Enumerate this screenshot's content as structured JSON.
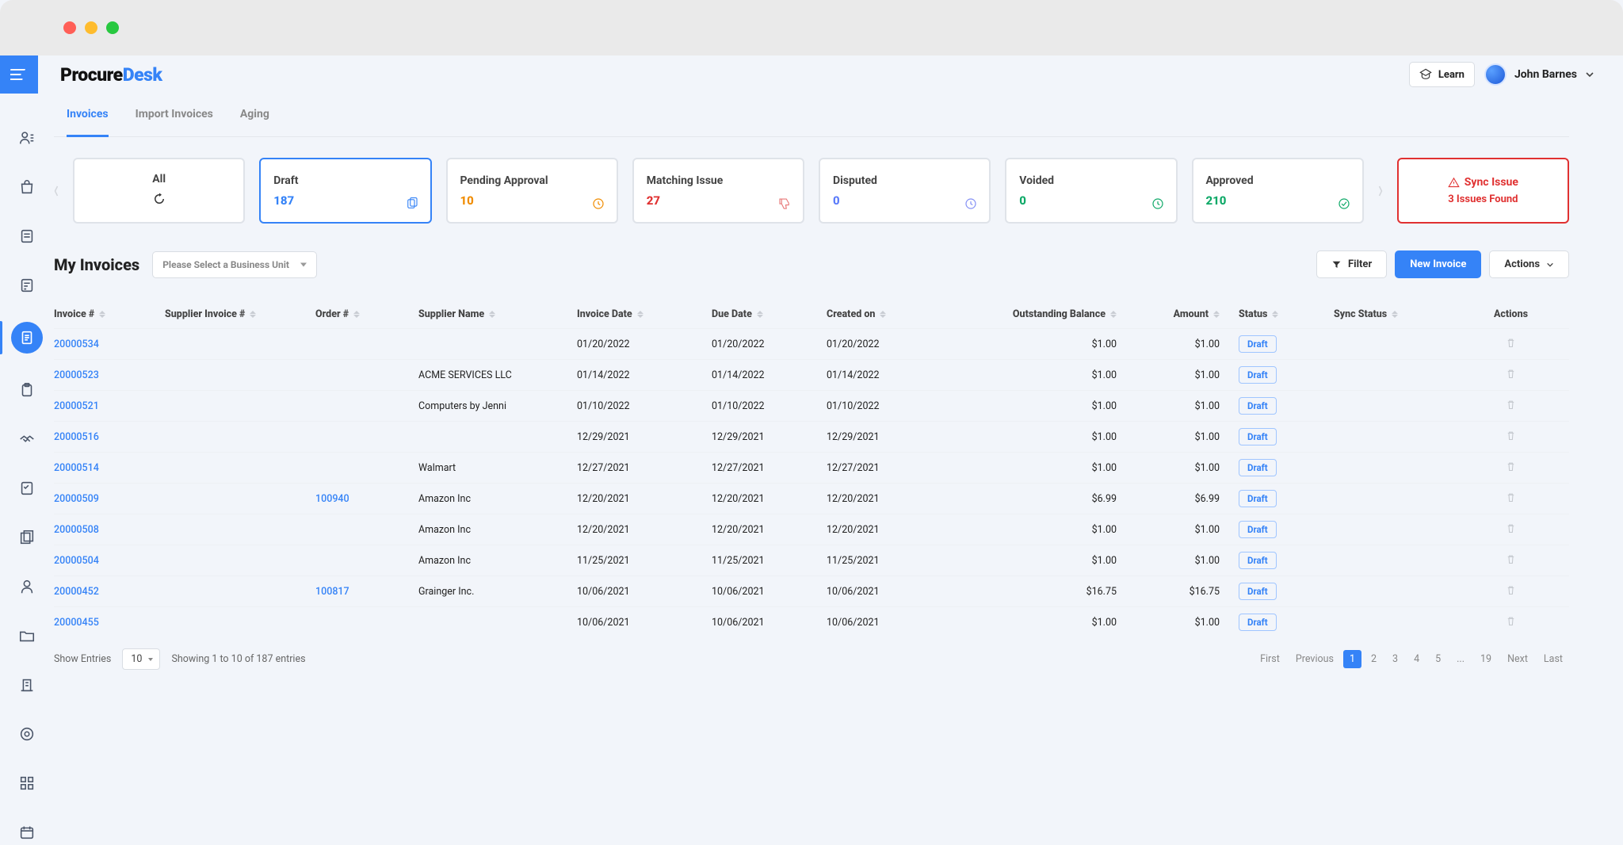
{
  "brand": {
    "p1": "Procure",
    "p2": "Desk"
  },
  "top": {
    "learn": "Learn",
    "user": "John Barnes"
  },
  "tabs": [
    {
      "label": "Invoices",
      "active": true
    },
    {
      "label": "Import Invoices",
      "active": false
    },
    {
      "label": "Aging",
      "active": false
    }
  ],
  "cards": {
    "all": {
      "title": "All"
    },
    "draft": {
      "title": "Draft",
      "count": "187"
    },
    "pending": {
      "title": "Pending Approval",
      "count": "10"
    },
    "matching": {
      "title": "Matching Issue",
      "count": "27"
    },
    "disputed": {
      "title": "Disputed",
      "count": "0"
    },
    "voided": {
      "title": "Voided",
      "count": "0"
    },
    "approved": {
      "title": "Approved",
      "count": "210"
    },
    "sync": {
      "line1": "Sync Issue",
      "line2": "3 Issues Found"
    }
  },
  "section": {
    "title": "My Invoices",
    "bu_placeholder": "Please Select a Business Unit",
    "filter": "Filter",
    "new": "New Invoice",
    "actions": "Actions"
  },
  "columns": {
    "invoice": "Invoice #",
    "sinvoice": "Supplier Invoice #",
    "order": "Order #",
    "sname": "Supplier Name",
    "idate": "Invoice Date",
    "ddate": "Due Date",
    "cdate": "Created on",
    "obal": "Outstanding Balance",
    "amount": "Amount",
    "status": "Status",
    "sync": "Sync Status",
    "actions": "Actions"
  },
  "rows": [
    {
      "inv": "20000534",
      "sinv": "",
      "order": "",
      "sname": "",
      "idate": "01/20/2022",
      "ddate": "01/20/2022",
      "cdate": "01/20/2022",
      "obal": "$1.00",
      "amount": "$1.00",
      "status": "Draft"
    },
    {
      "inv": "20000523",
      "sinv": "",
      "order": "",
      "sname": "ACME SERVICES LLC",
      "idate": "01/14/2022",
      "ddate": "01/14/2022",
      "cdate": "01/14/2022",
      "obal": "$1.00",
      "amount": "$1.00",
      "status": "Draft"
    },
    {
      "inv": "20000521",
      "sinv": "",
      "order": "",
      "sname": "Computers by Jenni",
      "idate": "01/10/2022",
      "ddate": "01/10/2022",
      "cdate": "01/10/2022",
      "obal": "$1.00",
      "amount": "$1.00",
      "status": "Draft"
    },
    {
      "inv": "20000516",
      "sinv": "",
      "order": "",
      "sname": "",
      "idate": "12/29/2021",
      "ddate": "12/29/2021",
      "cdate": "12/29/2021",
      "obal": "$1.00",
      "amount": "$1.00",
      "status": "Draft"
    },
    {
      "inv": "20000514",
      "sinv": "",
      "order": "",
      "sname": "Walmart",
      "idate": "12/27/2021",
      "ddate": "12/27/2021",
      "cdate": "12/27/2021",
      "obal": "$1.00",
      "amount": "$1.00",
      "status": "Draft"
    },
    {
      "inv": "20000509",
      "sinv": "",
      "order": "100940",
      "sname": "Amazon Inc",
      "idate": "12/20/2021",
      "ddate": "12/20/2021",
      "cdate": "12/20/2021",
      "obal": "$6.99",
      "amount": "$6.99",
      "status": "Draft"
    },
    {
      "inv": "20000508",
      "sinv": "",
      "order": "",
      "sname": "Amazon Inc",
      "idate": "12/20/2021",
      "ddate": "12/20/2021",
      "cdate": "12/20/2021",
      "obal": "$1.00",
      "amount": "$1.00",
      "status": "Draft"
    },
    {
      "inv": "20000504",
      "sinv": "",
      "order": "",
      "sname": "Amazon Inc",
      "idate": "11/25/2021",
      "ddate": "11/25/2021",
      "cdate": "11/25/2021",
      "obal": "$1.00",
      "amount": "$1.00",
      "status": "Draft"
    },
    {
      "inv": "20000452",
      "sinv": "",
      "order": "100817",
      "sname": "Grainger Inc.",
      "idate": "10/06/2021",
      "ddate": "10/06/2021",
      "cdate": "10/06/2021",
      "obal": "$16.75",
      "amount": "$16.75",
      "status": "Draft"
    },
    {
      "inv": "20000455",
      "sinv": "",
      "order": "",
      "sname": "",
      "idate": "10/06/2021",
      "ddate": "10/06/2021",
      "cdate": "10/06/2021",
      "obal": "$1.00",
      "amount": "$1.00",
      "status": "Draft"
    }
  ],
  "footer": {
    "show": "Show Entries",
    "perpage": "10",
    "info": "Showing 1 to 10 of 187 entries",
    "first": "First",
    "prev": "Previous",
    "pages": [
      "1",
      "2",
      "3",
      "4",
      "5",
      "...",
      "19"
    ],
    "next": "Next",
    "last": "Last"
  }
}
